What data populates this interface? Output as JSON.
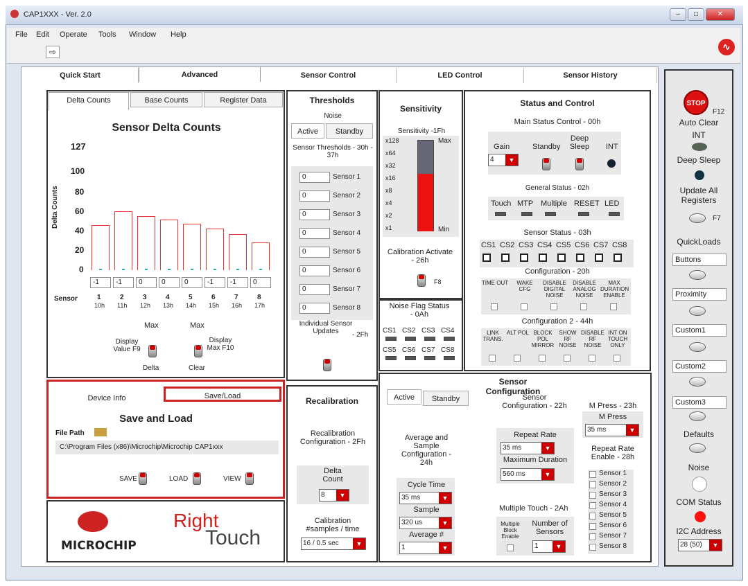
{
  "window": {
    "title": "CAP1XXX - Ver. 2.0",
    "min": "–",
    "max": "□",
    "close": "✕"
  },
  "menu": [
    "File",
    "Edit",
    "Operate",
    "Tools",
    "Window",
    "Help"
  ],
  "tabs": [
    "Quick Start",
    "Advanced",
    "Sensor Control",
    "LED Control",
    "Sensor History"
  ],
  "delta": {
    "subtabs": [
      "Delta Counts",
      "Base Counts",
      "Register Data"
    ],
    "title": "Sensor Delta Counts",
    "ylabel": "Delta Counts",
    "top_value": "127",
    "yticks": [
      "100",
      "80",
      "60",
      "40",
      "20",
      "0"
    ],
    "bar_values": [
      50,
      65,
      60,
      56,
      51,
      46,
      40,
      31
    ],
    "inputs": [
      "-1",
      "-1",
      "0",
      "0",
      "0",
      "-1",
      "-1",
      "0"
    ],
    "sensor_label": "Sensor",
    "sensor_nums": [
      "1",
      "2",
      "3",
      "4",
      "5",
      "6",
      "7",
      "8"
    ],
    "regs": [
      "10h",
      "11h",
      "12h",
      "13h",
      "14h",
      "15h",
      "16h",
      "17h"
    ],
    "max1": "Max",
    "max2": "Max",
    "disp_value": "Display Value F9",
    "delta_lbl": "Delta",
    "disp_max": "Display Max F10",
    "clear_lbl": "Clear"
  },
  "thresholds": {
    "title": "Thresholds",
    "noise": "Noise",
    "active": "Active",
    "standby": "Standby",
    "subtitle": "Sensor Thresholds - 30h - 37h",
    "values": [
      "0",
      "0",
      "0",
      "0",
      "0",
      "0",
      "0",
      "0"
    ],
    "labels": [
      "Sensor 1",
      "Sensor 2",
      "Sensor 3",
      "Sensor 4",
      "Sensor 5",
      "Sensor 6",
      "Sensor 7",
      "Sensor 8"
    ],
    "individual": "Individual Sensor Updates",
    "code": "- 2Fh"
  },
  "sensitivity": {
    "title": "Sensitivity",
    "sub": "Sensitivity -1Fh",
    "levels": [
      "x128",
      "x64",
      "x32",
      "x16",
      "x8",
      "x4",
      "x2",
      "x1"
    ],
    "max": "Max",
    "min": "Min",
    "level": 0.63,
    "cal": "Calibration Activate - 26h",
    "f8": "F8"
  },
  "noiseflag": {
    "title": "Noise Flag Status - 0Ah",
    "labels": [
      "CS1",
      "CS2",
      "CS3",
      "CS4",
      "CS5",
      "CS6",
      "CS7",
      "CS8"
    ]
  },
  "status": {
    "title": "Status and Control",
    "main": "Main Status Control - 00h",
    "gain": "Gain",
    "gain_val": "4",
    "standby": "Standby",
    "deep": "Deep Sleep",
    "int": "INT",
    "general": "General Status - 02h",
    "general_items": [
      "Touch",
      "MTP",
      "Multiple",
      "RESET",
      "LED"
    ],
    "sensor_status": "Sensor Status - 03h",
    "cs": [
      "CS1",
      "CS2",
      "CS3",
      "CS4",
      "CS5",
      "CS6",
      "CS7",
      "CS8"
    ],
    "config": "Configuration - 20h",
    "config_items": [
      "TIME OUT",
      "WAKE CFG",
      "DISABLE DIGITAL NOISE",
      "DISABLE ANALOG NOISE",
      "MAX DURATION ENABLE"
    ],
    "config2": "Configuration 2 - 44h",
    "config2_items": [
      "LINK TRANS.",
      "ALT POL",
      "BLOCK POL MIRROR",
      "SHOW RF NOISE",
      "DISABLE RF NOISE",
      "INT ON TOUCH ONLY"
    ]
  },
  "device": {
    "tabs": [
      "Device Info",
      "Save/Load"
    ],
    "title": "Save and Load",
    "filepath": "File Path",
    "path": "C:\\Program Files (x86)\\Microchip\\Microchip CAP1xxx",
    "save": "SAVE",
    "load": "LOAD",
    "view": "VIEW"
  },
  "logo": {
    "microchip": "MICROCHIP",
    "right": "Right",
    "touch": "Touch"
  },
  "recal": {
    "title": "Recalibration",
    "cfg": "Recalibration Configuration - 2Fh",
    "delta": "Delta Count",
    "delta_val": "8",
    "cal": "Calibration #samples / time",
    "cal_val": "16 / 0.5 sec"
  },
  "sensorcfg": {
    "title": "Sensor Configuration",
    "active": "Active",
    "standby": "Standby",
    "avg": "Average and Sample Configuration - 24h",
    "cycle": "Cycle Time",
    "cycle_val": "35 ms",
    "sample": "Sample",
    "sample_val": "320 us",
    "avgn": "Average #",
    "avgn_val": "1",
    "sc": "Sensor Configuration - 22h",
    "repeat": "Repeat Rate",
    "repeat_val": "35 ms",
    "maxdur": "Maximum Duration",
    "maxdur_val": "560 ms",
    "mpress_t": "M Press - 23h",
    "mpress": "M Press",
    "mpress_val": "35 ms",
    "rre": "Repeat Rate Enable - 28h",
    "rre_items": [
      "Sensor 1",
      "Sensor 2",
      "Sensor 3",
      "Sensor 4",
      "Sensor 5",
      "Sensor 6",
      "Sensor 7",
      "Sensor 8"
    ],
    "multi": "Multiple Touch - 2Ah",
    "mbe": "Multiple Block Enable",
    "num": "Number of Sensors",
    "num_val": "1"
  },
  "right": {
    "stop": "STOP",
    "f12": "F12",
    "autoclear": "Auto Clear",
    "int": "INT",
    "deepsleep": "Deep Sleep",
    "update": "Update All Registers",
    "f7": "F7",
    "quickloads": "QuickLoads",
    "ql": [
      "Buttons",
      "Proximity",
      "Custom1",
      "Custom2",
      "Custom3"
    ],
    "defaults": "Defaults",
    "noise": "Noise",
    "com": "COM Status",
    "i2c": "I2C Address",
    "i2c_val": "28 (50)"
  }
}
